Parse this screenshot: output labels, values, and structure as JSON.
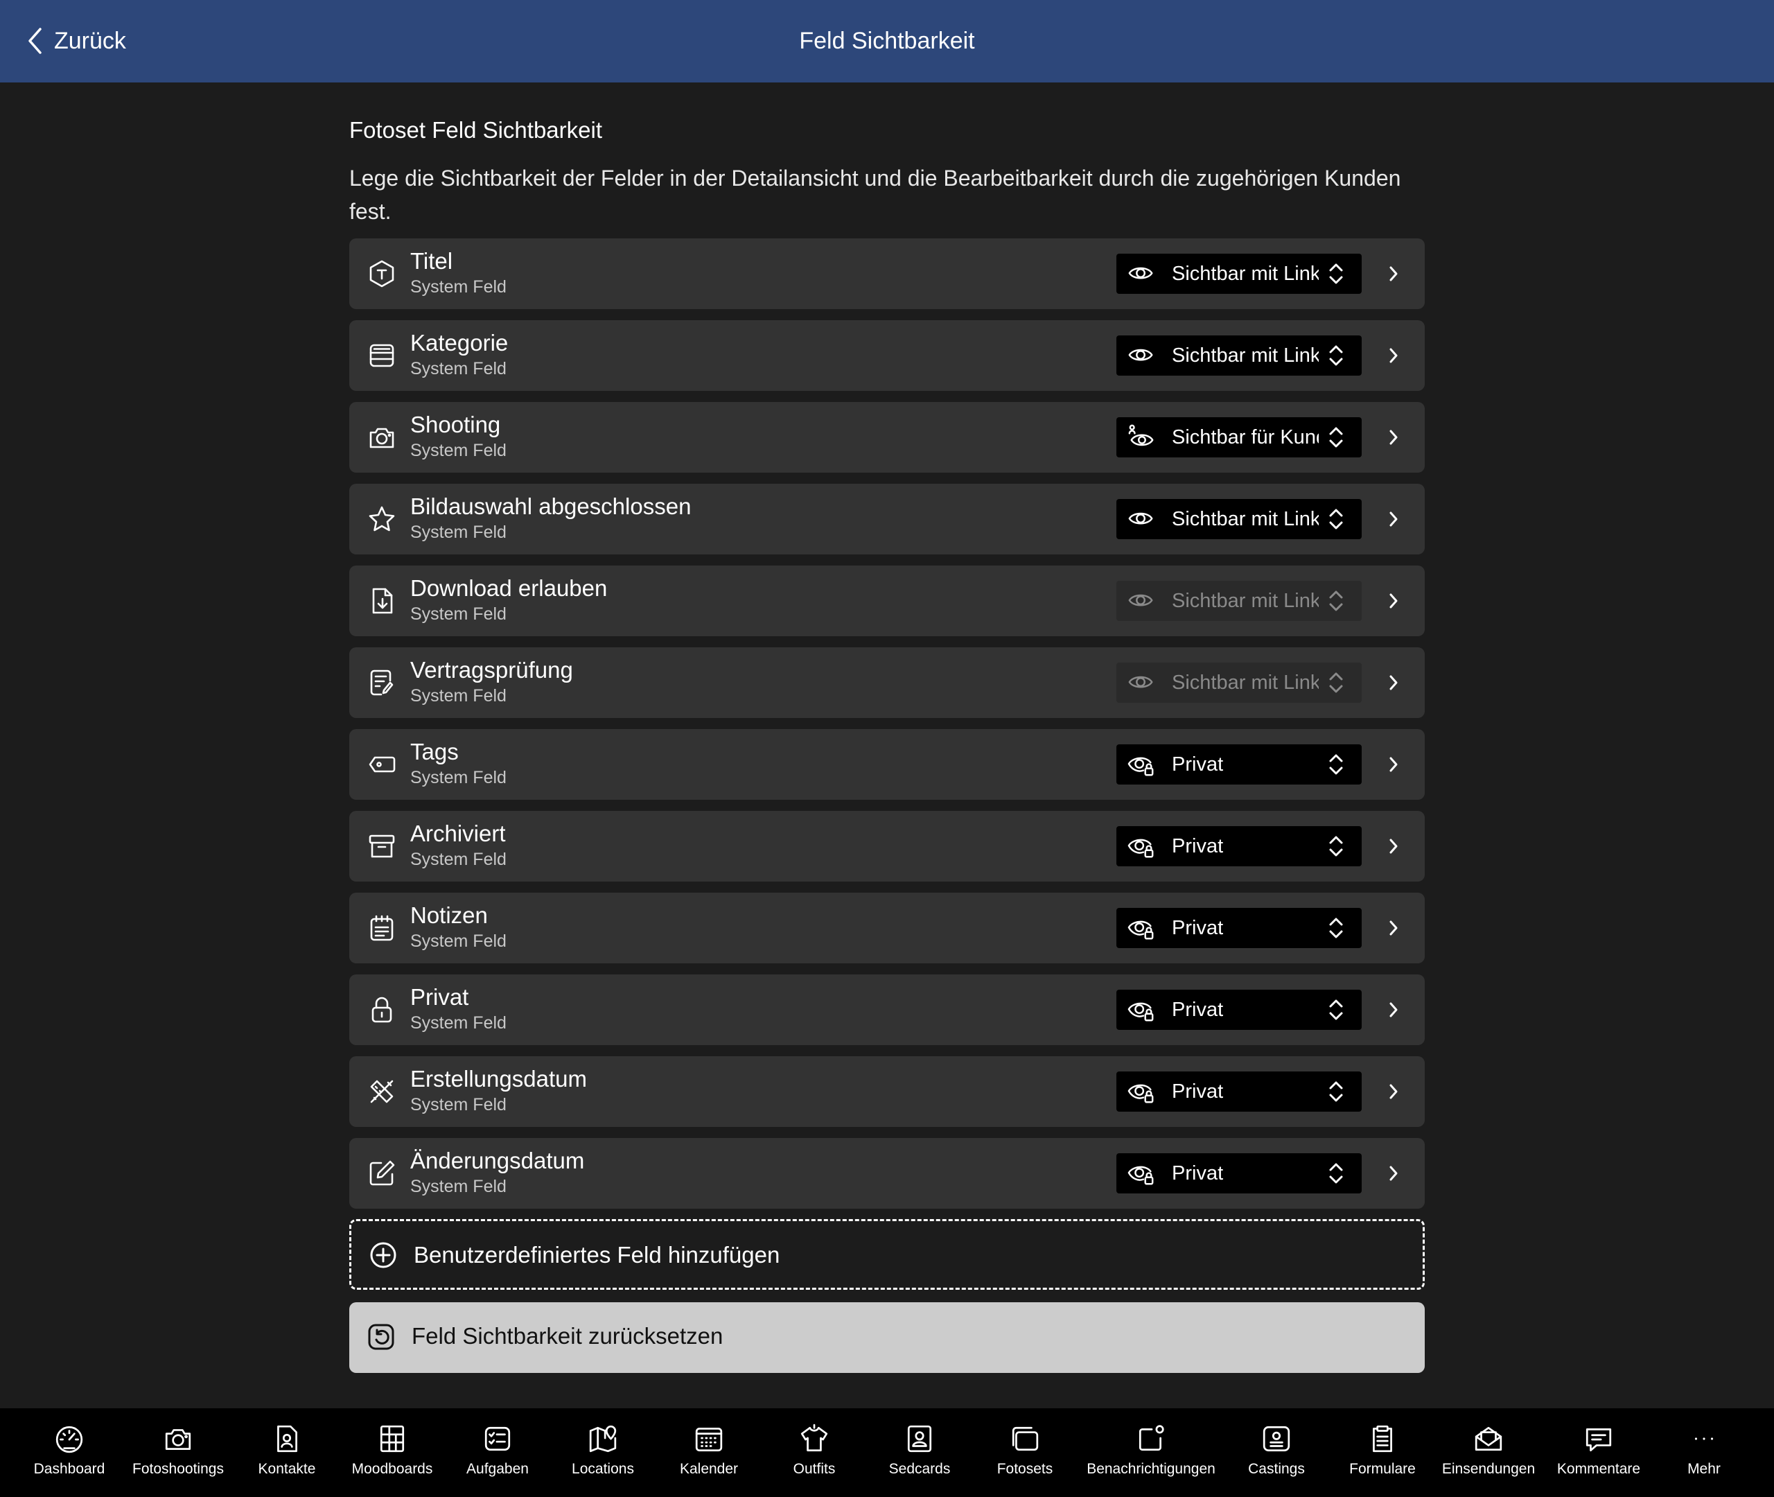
{
  "header": {
    "back_label": "Zurück",
    "title": "Feld Sichtbarkeit"
  },
  "section": {
    "title": "Fotoset Feld Sichtbarkeit",
    "description": "Lege die Sichtbarkeit der Felder in der Detailansicht und die Bearbeitbarkeit durch die zugehörigen Kunden fest."
  },
  "fields": [
    {
      "name": "Titel",
      "sub": "System Feld",
      "icon": "title-tag-icon",
      "visibility": "Sichtbar mit Link",
      "vis_icon": "eye-icon",
      "disabled": false
    },
    {
      "name": "Kategorie",
      "sub": "System Feld",
      "icon": "category-tray-icon",
      "visibility": "Sichtbar mit Link",
      "vis_icon": "eye-icon",
      "disabled": false
    },
    {
      "name": "Shooting",
      "sub": "System Feld",
      "icon": "camera-icon",
      "visibility": "Sichtbar für Kunden",
      "vis_icon": "eye-customer-icon",
      "disabled": false
    },
    {
      "name": "Bildauswahl abgeschlossen",
      "sub": "System Feld",
      "icon": "star-icon",
      "visibility": "Sichtbar mit Link",
      "vis_icon": "eye-icon",
      "disabled": false
    },
    {
      "name": "Download erlauben",
      "sub": "System Feld",
      "icon": "file-download-icon",
      "visibility": "Sichtbar mit Link",
      "vis_icon": "eye-icon",
      "disabled": true
    },
    {
      "name": "Vertragsprüfung",
      "sub": "System Feld",
      "icon": "contract-edit-icon",
      "visibility": "Sichtbar mit Link",
      "vis_icon": "eye-icon",
      "disabled": true
    },
    {
      "name": "Tags",
      "sub": "System Feld",
      "icon": "tag-icon",
      "visibility": "Privat",
      "vis_icon": "eye-lock-icon",
      "disabled": false
    },
    {
      "name": "Archiviert",
      "sub": "System Feld",
      "icon": "archive-box-icon",
      "visibility": "Privat",
      "vis_icon": "eye-lock-icon",
      "disabled": false
    },
    {
      "name": "Notizen",
      "sub": "System Feld",
      "icon": "notes-icon",
      "visibility": "Privat",
      "vis_icon": "eye-lock-icon",
      "disabled": false
    },
    {
      "name": "Privat",
      "sub": "System Feld",
      "icon": "lock-icon",
      "visibility": "Privat",
      "vis_icon": "eye-lock-icon",
      "disabled": false
    },
    {
      "name": "Erstellungsdatum",
      "sub": "System Feld",
      "icon": "ruler-pencil-icon",
      "visibility": "Privat",
      "vis_icon": "eye-lock-icon",
      "disabled": false
    },
    {
      "name": "Änderungsdatum",
      "sub": "System Feld",
      "icon": "edit-square-icon",
      "visibility": "Privat",
      "vis_icon": "eye-lock-icon",
      "disabled": false
    }
  ],
  "actions": {
    "add_custom_field": "Benutzerdefiniertes Feld hinzufügen",
    "reset_visibility": "Feld Sichtbarkeit zurücksetzen"
  },
  "tabbar": [
    {
      "label": "Dashboard",
      "icon": "dashboard-gauge-icon"
    },
    {
      "label": "Fotoshootings",
      "icon": "camera-icon"
    },
    {
      "label": "Kontakte",
      "icon": "contact-file-icon"
    },
    {
      "label": "Moodboards",
      "icon": "moodboard-grid-icon"
    },
    {
      "label": "Aufgaben",
      "icon": "tasks-checklist-icon"
    },
    {
      "label": "Locations",
      "icon": "map-pin-icon"
    },
    {
      "label": "Kalender",
      "icon": "calendar-icon"
    },
    {
      "label": "Outfits",
      "icon": "shirt-icon"
    },
    {
      "label": "Sedcards",
      "icon": "sedcard-person-icon"
    },
    {
      "label": "Fotosets",
      "icon": "photo-stack-icon"
    },
    {
      "label": "Benachrichtigungen",
      "icon": "notification-icon"
    },
    {
      "label": "Castings",
      "icon": "casting-id-icon"
    },
    {
      "label": "Formulare",
      "icon": "form-clipboard-icon"
    },
    {
      "label": "Einsendungen",
      "icon": "submission-mail-icon"
    },
    {
      "label": "Kommentare",
      "icon": "comment-bubble-icon"
    },
    {
      "label": "Mehr",
      "icon": "more-dots-icon"
    }
  ]
}
